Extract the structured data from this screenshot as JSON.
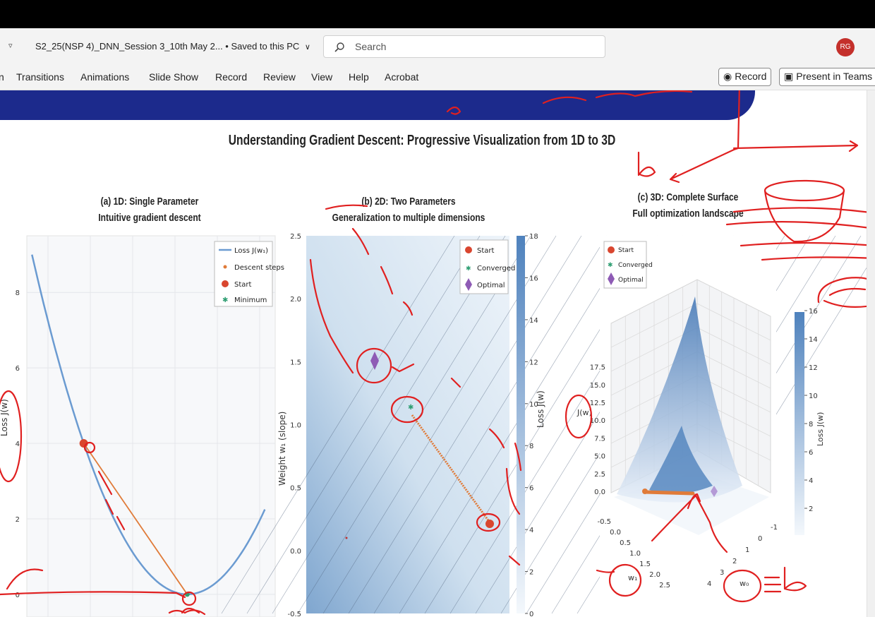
{
  "titlebar": {
    "qat_arrow": "▿",
    "doc_title": "S2_25(NSP 4)_DNN_Session 3_10th May 2... • Saved to this PC",
    "save_chevron": "∨",
    "search_placeholder": "Search",
    "user_initials": "RG"
  },
  "ribbon": {
    "tabs": [
      "n",
      "Transitions",
      "Animations",
      "Slide Show",
      "Record",
      "Review",
      "View",
      "Help",
      "Acrobat"
    ],
    "record_button": "Record",
    "present_button": "Present in Teams"
  },
  "slide": {
    "title": "Understanding Gradient Descent: Progressive Visualization from 1D to 3D",
    "banner_color": "#1c2a8c",
    "annotation_color": "#e02020"
  },
  "chart_data": [
    {
      "type": "line",
      "title": "(a) 1D: Single Parameter",
      "subtitle": "Intuitive gradient descent",
      "xlabel": "",
      "ylabel": "Loss J(w)",
      "ylim": [
        0,
        9.5
      ],
      "y_ticks": [
        "0",
        "2",
        "4",
        "6",
        "8"
      ],
      "legend_position": "top-right",
      "legend": [
        "Loss J(w₁)",
        "Descent steps",
        "Start",
        "Minimum"
      ],
      "series": [
        {
          "name": "Loss J(w₁)",
          "curve": "parabola",
          "x": [
            -3.0,
            -2.0,
            -1.0,
            0.0,
            1.0,
            1.5
          ],
          "y": [
            9.3,
            4.0,
            1.0,
            0.0,
            1.0,
            2.3
          ],
          "color": "#6b9bd1"
        },
        {
          "name": "Descent steps",
          "x": [
            -2.0,
            0.0
          ],
          "y": [
            4.0,
            0.0
          ],
          "color": "#e07b39"
        },
        {
          "name": "Start",
          "x": [
            -2.0
          ],
          "y": [
            4.0
          ],
          "color": "#d9462f"
        },
        {
          "name": "Minimum",
          "x": [
            0.0
          ],
          "y": [
            0.0
          ],
          "color": "#2e9e72"
        }
      ],
      "grid": true
    },
    {
      "type": "heatmap",
      "title": "(b) 2D: Two Parameters",
      "subtitle": "Generalization to multiple dimensions",
      "xlabel": "",
      "ylabel": "Weight w₁ (slope)",
      "ylim": [
        -0.5,
        2.5
      ],
      "y_ticks": [
        "-0.5",
        "0.0",
        "0.5",
        "1.0",
        "1.5",
        "2.0",
        "2.5"
      ],
      "colorbar_label": "Loss J(w)",
      "colorbar_ticks": [
        "0",
        "2",
        "4",
        "6",
        "8",
        "10",
        "12",
        "14",
        "16",
        "18"
      ],
      "legend_position": "top-right",
      "legend": [
        "Start",
        "Converged",
        "Optimal"
      ],
      "points": [
        {
          "name": "Start",
          "w1": 0.2,
          "color": "#d9462f"
        },
        {
          "name": "Converged",
          "w1": 1.15,
          "color": "#2e9e72"
        },
        {
          "name": "Optimal",
          "w1": 1.5,
          "color": "#8e5bb5"
        }
      ],
      "path_color": "#e07b39"
    },
    {
      "type": "area",
      "title": "(c) 3D: Complete Surface",
      "subtitle": "Full optimization landscape",
      "zlabel": "J(w)",
      "x_axis_label": "w₁",
      "y_axis_label": "w₀",
      "z_ticks": [
        "0.0",
        "2.5",
        "5.0",
        "7.5",
        "10.0",
        "12.5",
        "15.0",
        "17.5"
      ],
      "w1_ticks": [
        "-0.5",
        "0.0",
        "0.5",
        "1.0",
        "1.5",
        "2.0",
        "2.5"
      ],
      "w0_ticks": [
        "-1",
        "0",
        "1",
        "2",
        "3",
        "4"
      ],
      "colorbar_label": "Loss J(w)",
      "colorbar_ticks": [
        "2",
        "4",
        "6",
        "8",
        "10",
        "12",
        "14",
        "16"
      ],
      "legend_position": "top-left",
      "legend": [
        "Start",
        "Converged",
        "Optimal"
      ],
      "colors": {
        "surface": "#5b8fc7",
        "path": "#e07b39",
        "optimal": "#8e5bb5"
      }
    }
  ]
}
